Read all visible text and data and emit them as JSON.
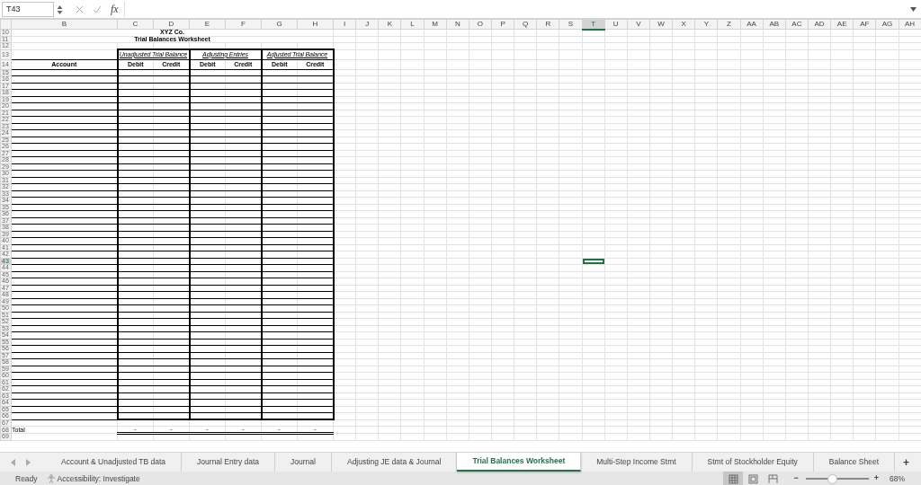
{
  "formula_bar": {
    "name_box": "T43",
    "function_label": "fx"
  },
  "columns": [
    {
      "label": "B",
      "selected": false
    },
    {
      "label": "C",
      "selected": false
    },
    {
      "label": "D",
      "selected": false
    },
    {
      "label": "E",
      "selected": false
    },
    {
      "label": "F",
      "selected": false
    },
    {
      "label": "G",
      "selected": false
    },
    {
      "label": "H",
      "selected": false
    },
    {
      "label": "I",
      "selected": false
    },
    {
      "label": "J",
      "selected": false
    },
    {
      "label": "K",
      "selected": false
    },
    {
      "label": "L",
      "selected": false
    },
    {
      "label": "M",
      "selected": false
    },
    {
      "label": "N",
      "selected": false
    },
    {
      "label": "O",
      "selected": false
    },
    {
      "label": "P",
      "selected": false
    },
    {
      "label": "Q",
      "selected": false
    },
    {
      "label": "R",
      "selected": false
    },
    {
      "label": "S",
      "selected": false
    },
    {
      "label": "T",
      "selected": true
    },
    {
      "label": "U",
      "selected": false
    },
    {
      "label": "V",
      "selected": false
    },
    {
      "label": "W",
      "selected": false
    },
    {
      "label": "X",
      "selected": false
    },
    {
      "label": "Y",
      "selected": false
    },
    {
      "label": "Z",
      "selected": false
    },
    {
      "label": "AA",
      "selected": false
    },
    {
      "label": "AB",
      "selected": false
    },
    {
      "label": "AC",
      "selected": false
    },
    {
      "label": "AD",
      "selected": false
    },
    {
      "label": "AE",
      "selected": false
    },
    {
      "label": "AF",
      "selected": false
    },
    {
      "label": "AG",
      "selected": false
    },
    {
      "label": "AH",
      "selected": false
    }
  ],
  "row_numbers": [
    {
      "label": "10",
      "selected": false
    },
    {
      "label": "11",
      "selected": false
    },
    {
      "label": "12",
      "selected": false
    },
    {
      "label": "13",
      "selected": false
    },
    {
      "label": "14",
      "selected": false
    },
    {
      "label": "15",
      "selected": false
    },
    {
      "label": "16",
      "selected": false
    },
    {
      "label": "17",
      "selected": false
    },
    {
      "label": "18",
      "selected": false
    },
    {
      "label": "19",
      "selected": false
    },
    {
      "label": "20",
      "selected": false
    },
    {
      "label": "21",
      "selected": false
    },
    {
      "label": "22",
      "selected": false
    },
    {
      "label": "23",
      "selected": false
    },
    {
      "label": "24",
      "selected": false
    },
    {
      "label": "25",
      "selected": false
    },
    {
      "label": "26",
      "selected": false
    },
    {
      "label": "27",
      "selected": false
    },
    {
      "label": "28",
      "selected": false
    },
    {
      "label": "29",
      "selected": false
    },
    {
      "label": "30",
      "selected": false
    },
    {
      "label": "31",
      "selected": false
    },
    {
      "label": "32",
      "selected": false
    },
    {
      "label": "33",
      "selected": false
    },
    {
      "label": "34",
      "selected": false
    },
    {
      "label": "35",
      "selected": false
    },
    {
      "label": "36",
      "selected": false
    },
    {
      "label": "37",
      "selected": false
    },
    {
      "label": "38",
      "selected": false
    },
    {
      "label": "39",
      "selected": false
    },
    {
      "label": "40",
      "selected": false
    },
    {
      "label": "41",
      "selected": false
    },
    {
      "label": "42",
      "selected": false
    },
    {
      "label": "43",
      "selected": true
    },
    {
      "label": "44",
      "selected": false
    },
    {
      "label": "45",
      "selected": false
    },
    {
      "label": "46",
      "selected": false
    },
    {
      "label": "47",
      "selected": false
    },
    {
      "label": "48",
      "selected": false
    },
    {
      "label": "49",
      "selected": false
    },
    {
      "label": "50",
      "selected": false
    },
    {
      "label": "51",
      "selected": false
    },
    {
      "label": "52",
      "selected": false
    },
    {
      "label": "53",
      "selected": false
    },
    {
      "label": "54",
      "selected": false
    },
    {
      "label": "55",
      "selected": false
    },
    {
      "label": "56",
      "selected": false
    },
    {
      "label": "57",
      "selected": false
    },
    {
      "label": "58",
      "selected": false
    },
    {
      "label": "59",
      "selected": false
    },
    {
      "label": "60",
      "selected": false
    },
    {
      "label": "61",
      "selected": false
    },
    {
      "label": "62",
      "selected": false
    },
    {
      "label": "63",
      "selected": false
    },
    {
      "label": "64",
      "selected": false
    },
    {
      "label": "65",
      "selected": false
    },
    {
      "label": "66",
      "selected": false
    },
    {
      "label": "67",
      "selected": false
    },
    {
      "label": "68",
      "selected": false
    },
    {
      "label": "69",
      "selected": false
    }
  ],
  "worksheet": {
    "company": "XYZ Co.",
    "title": "Trial Balances Worksheet",
    "account_header": "Account",
    "groups": [
      {
        "label": "Unadjusted Trial Balance",
        "columns": [
          "Debit",
          "Credit"
        ]
      },
      {
        "label": "Adjusting Entries",
        "columns": [
          "Debit",
          "Credit"
        ]
      },
      {
        "label": "Adjusted Trial Balance",
        "columns": [
          "Debit",
          "Credit"
        ]
      }
    ],
    "total_label": "Total",
    "totals": [
      "-",
      "-",
      "-",
      "-",
      "-",
      "-"
    ]
  },
  "sheet_tabs": [
    {
      "label": "Account & Unadjusted TB data",
      "selected": false
    },
    {
      "label": "Journal Entry data",
      "selected": false
    },
    {
      "label": "Journal",
      "selected": false
    },
    {
      "label": "Adjusting JE data & Journal",
      "selected": false
    },
    {
      "label": "Trial Balances Worksheet",
      "selected": true
    },
    {
      "label": "Multi-Step Income Stmt",
      "selected": false
    },
    {
      "label": "Stmt of Stockholder Equity",
      "selected": false
    },
    {
      "label": "Balance Sheet",
      "selected": false
    }
  ],
  "add_sheet": "+",
  "status_bar": {
    "status": "Ready",
    "accessibility": "Accessibility: Investigate",
    "view_buttons": [
      {
        "kind": "normal",
        "selected": true
      },
      {
        "kind": "page_layout",
        "selected": false
      },
      {
        "kind": "page_break",
        "selected": false
      }
    ],
    "zoom_out": "−",
    "zoom_in": "+",
    "zoom": {
      "level": 0.42,
      "reading": "68%"
    }
  }
}
